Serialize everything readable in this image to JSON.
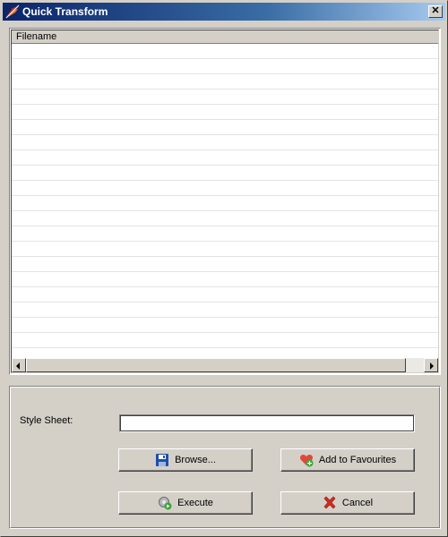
{
  "window": {
    "title": "Quick Transform",
    "close_glyph": "✕"
  },
  "file_list": {
    "column_header": "Filename",
    "rows": []
  },
  "style_sheet": {
    "label": "Style Sheet:",
    "value": "",
    "placeholder": ""
  },
  "buttons": {
    "browse": {
      "label": "Browse...",
      "icon": "floppy-disk-icon"
    },
    "add_favourites": {
      "label": "Add to Favourites",
      "icon": "heart-plus-icon"
    },
    "execute": {
      "label": "Execute",
      "icon": "gear-play-icon"
    },
    "cancel": {
      "label": "Cancel",
      "icon": "red-x-icon"
    }
  },
  "colors": {
    "titlebar_start": "#0a246a",
    "titlebar_end": "#a6caf0",
    "face": "#d4d0c8"
  }
}
